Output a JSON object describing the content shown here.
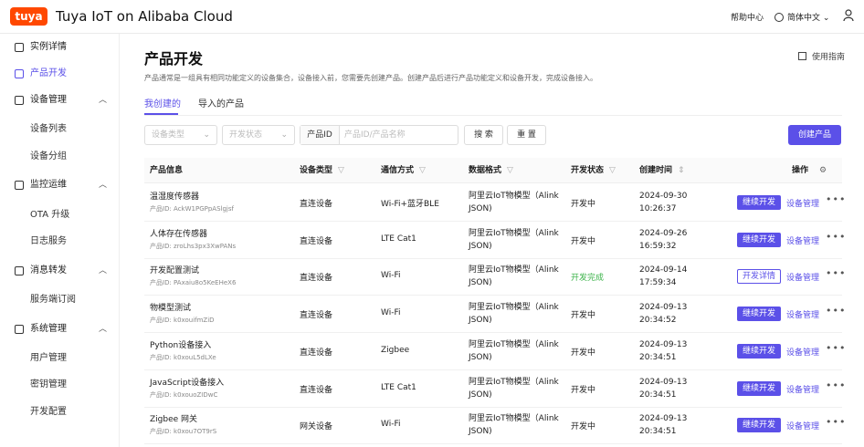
{
  "header": {
    "logo_text": "tuya",
    "title": "Tuya IoT on Alibaba Cloud",
    "help": "帮助中心",
    "language": "简体中文"
  },
  "sidebar": {
    "items": [
      {
        "label": "实例详情",
        "icon": "instance-icon"
      },
      {
        "label": "产品开发",
        "icon": "product-icon"
      },
      {
        "label": "设备管理",
        "icon": "device-icon"
      },
      {
        "label": "设备列表"
      },
      {
        "label": "设备分组"
      },
      {
        "label": "监控运维",
        "icon": "monitor-icon"
      },
      {
        "label": "OTA 升级"
      },
      {
        "label": "日志服务"
      },
      {
        "label": "消息转发",
        "icon": "message-icon"
      },
      {
        "label": "服务端订阅"
      },
      {
        "label": "系统管理",
        "icon": "system-icon"
      },
      {
        "label": "用户管理"
      },
      {
        "label": "密钥管理"
      },
      {
        "label": "开发配置"
      }
    ]
  },
  "page": {
    "title": "产品开发",
    "guide": "使用指南",
    "description": "产品通常是一组具有相同功能定义的设备集合，设备接入前，您需要先创建产品。创建产品后进行产品功能定义和设备开发，完成设备接入。",
    "tabs": [
      "我创建的",
      "导入的产品"
    ]
  },
  "filters": {
    "device_type_placeholder": "设备类型",
    "dev_status_placeholder": "开发状态",
    "product_id_label": "产品ID",
    "search_placeholder": "产品ID/产品名称",
    "search_button": "搜 索",
    "reset_button": "重 置",
    "create_button": "创建产品"
  },
  "table": {
    "headers": {
      "info": "产品信息",
      "type": "设备类型",
      "comm": "通信方式",
      "format": "数据格式",
      "status": "开发状态",
      "time": "创建时间",
      "ops": "操作"
    },
    "rows": [
      {
        "name": "温湿度传感器",
        "pid": "产品ID: AckW1PGPpASlgjsf",
        "type": "直连设备",
        "comm": "Wi-Fi+蓝牙BLE",
        "format1": "阿里云IoT物模型（Alink",
        "format2": "JSON)",
        "status": "开发中",
        "date": "2024-09-30",
        "clock": "10:26:37",
        "action": "继续开发",
        "manage": "设备管理"
      },
      {
        "name": "人体存在传感器",
        "pid": "产品ID: zroLhs3px3XwPANs",
        "type": "直连设备",
        "comm": "LTE Cat1",
        "format1": "阿里云IoT物模型（Alink",
        "format2": "JSON)",
        "status": "开发中",
        "date": "2024-09-26",
        "clock": "16:59:32",
        "action": "继续开发",
        "manage": "设备管理"
      },
      {
        "name": "开发配置测试",
        "pid": "产品ID: PAxaiu8o5KeEHeX6",
        "type": "直连设备",
        "comm": "Wi-Fi",
        "format1": "阿里云IoT物模型（Alink",
        "format2": "JSON)",
        "status": "开发完成",
        "date": "2024-09-14",
        "clock": "17:59:34",
        "action": "开发详情",
        "manage": "设备管理"
      },
      {
        "name": "物模型测试",
        "pid": "产品ID: k0xouifmZiD",
        "type": "直连设备",
        "comm": "Wi-Fi",
        "format1": "阿里云IoT物模型（Alink",
        "format2": "JSON)",
        "status": "开发中",
        "date": "2024-09-13",
        "clock": "20:34:52",
        "action": "继续开发",
        "manage": "设备管理"
      },
      {
        "name": "Python设备接入",
        "pid": "产品ID: k0xouL5dLXe",
        "type": "直连设备",
        "comm": "Zigbee",
        "format1": "阿里云IoT物模型（Alink",
        "format2": "JSON)",
        "status": "开发中",
        "date": "2024-09-13",
        "clock": "20:34:51",
        "action": "继续开发",
        "manage": "设备管理"
      },
      {
        "name": "JavaScript设备接入",
        "pid": "产品ID: k0xouoZIDwC",
        "type": "直连设备",
        "comm": "LTE Cat1",
        "format1": "阿里云IoT物模型（Alink",
        "format2": "JSON)",
        "status": "开发中",
        "date": "2024-09-13",
        "clock": "20:34:51",
        "action": "继续开发",
        "manage": "设备管理"
      },
      {
        "name": "Zigbee 网关",
        "pid": "产品ID: k0xou7OT9rS",
        "type": "网关设备",
        "comm": "Wi-Fi",
        "format1": "阿里云IoT物模型（Alink",
        "format2": "JSON)",
        "status": "开发中",
        "date": "2024-09-13",
        "clock": "20:34:51",
        "action": "继续开发",
        "manage": "设备管理"
      }
    ]
  },
  "colors": {
    "accent": "#5b50e8",
    "brand": "#ff4800",
    "done": "#3cb34a"
  }
}
